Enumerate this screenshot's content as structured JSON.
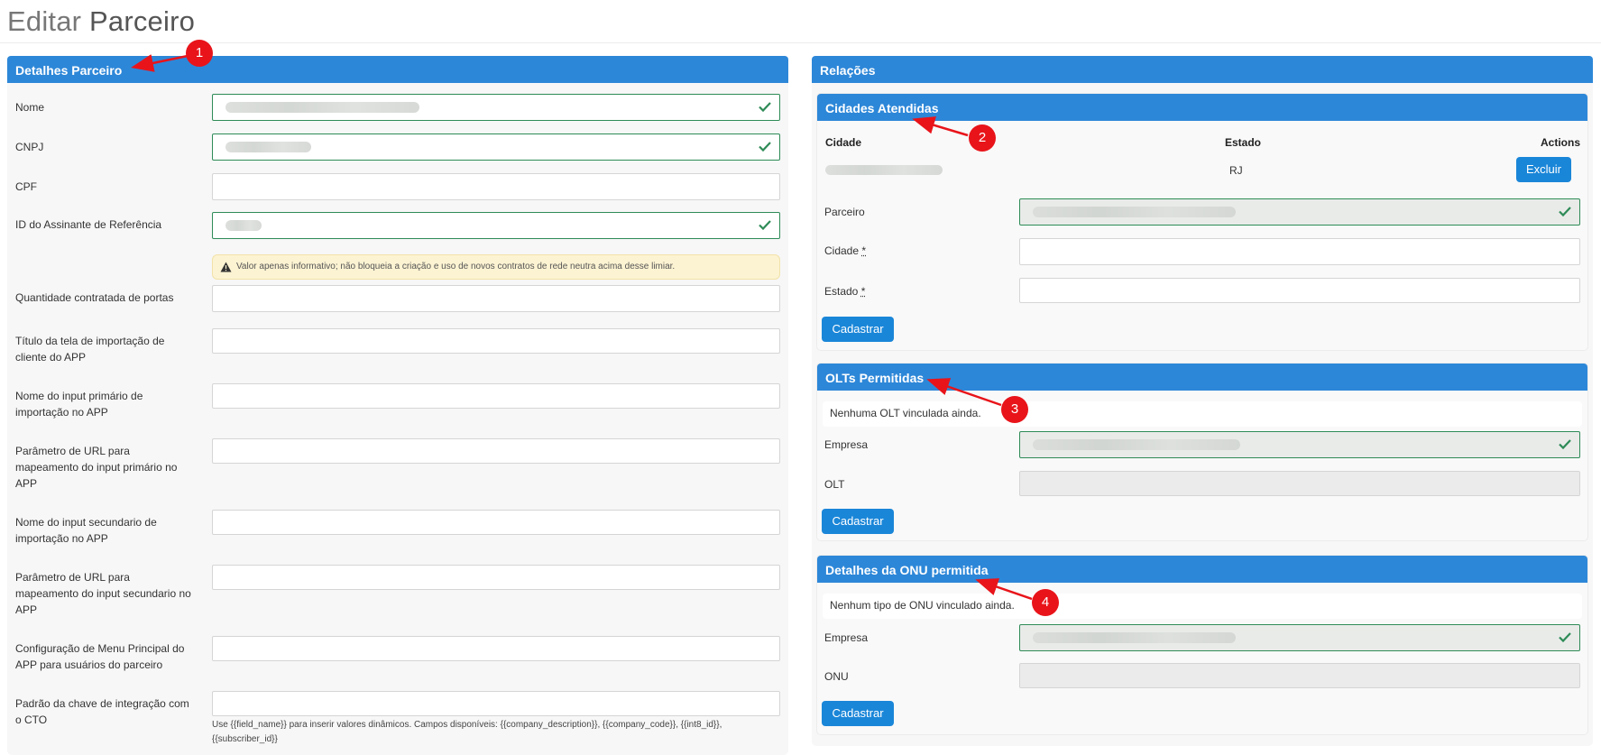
{
  "page": {
    "title_light": "Editar",
    "title_bold": "Parceiro"
  },
  "left_panel": {
    "header": "Detalhes Parceiro",
    "fields": {
      "nome": "Nome",
      "cnpj": "CNPJ",
      "cpf": "CPF",
      "id_assinante": "ID do Assinante de Referência",
      "qtd_portas": "Quantidade contratada de portas",
      "titulo_tela_l1": "Título da tela de importação de",
      "titulo_tela_l2": "cliente do APP",
      "input_primario_l1": "Nome do input primário de",
      "input_primario_l2": "importação no APP",
      "param_primario_l1": "Parâmetro de URL para",
      "param_primario_l2": "mapeamento do input primário no",
      "param_primario_l3": "APP",
      "input_secundario_l1": "Nome do input secundario de",
      "input_secundario_l2": "importação no APP",
      "param_secundario_l1": "Parâmetro de URL para",
      "param_secundario_l2": "mapeamento do input secundario no",
      "param_secundario_l3": "APP",
      "menu_l1": "Configuração de Menu Principal do",
      "menu_l2": "APP para usuários do parceiro",
      "chave_l1": "Padrão da chave de integração com",
      "chave_l2": "o CTO"
    },
    "warning": "Valor apenas informativo; não bloqueia a criação e uso de novos contratos de rede neutra acima desse limiar.",
    "help_l1": "Use {{field_name}} para inserir valores dinâmicos. Campos disponíveis: {{company_description}}, {{company_code}}, {{int8_id}},",
    "help_l2": "{{subscriber_id}}"
  },
  "right_panel": {
    "header": "Relações",
    "cidades": {
      "header": "Cidades Atendidas",
      "col_cidade": "Cidade",
      "col_estado": "Estado",
      "col_actions": "Actions",
      "row_estado": "RJ",
      "delete_label": "Excluir",
      "parceiro_label": "Parceiro",
      "cidade_label": "Cidade",
      "estado_label": "Estado",
      "required_mark": "*",
      "submit_label": "Cadastrar"
    },
    "olts": {
      "header": "OLTs Permitidas",
      "empty_note": "Nenhuma OLT vinculada ainda.",
      "empresa_label": "Empresa",
      "olt_label": "OLT",
      "submit_label": "Cadastrar"
    },
    "onu": {
      "header": "Detalhes da ONU permitida",
      "empty_note": "Nenhum tipo de ONU vinculado ainda.",
      "empresa_label": "Empresa",
      "onu_label": "ONU",
      "submit_label": "Cadastrar"
    }
  },
  "annotations": [
    "1",
    "2",
    "3",
    "4"
  ],
  "colors": {
    "header_blue": "#2d87d8",
    "button_blue": "#1a86d8",
    "valid_green": "#2e8b57",
    "marker_red": "#e8141a",
    "warning_bg": "#fcf3d2"
  }
}
